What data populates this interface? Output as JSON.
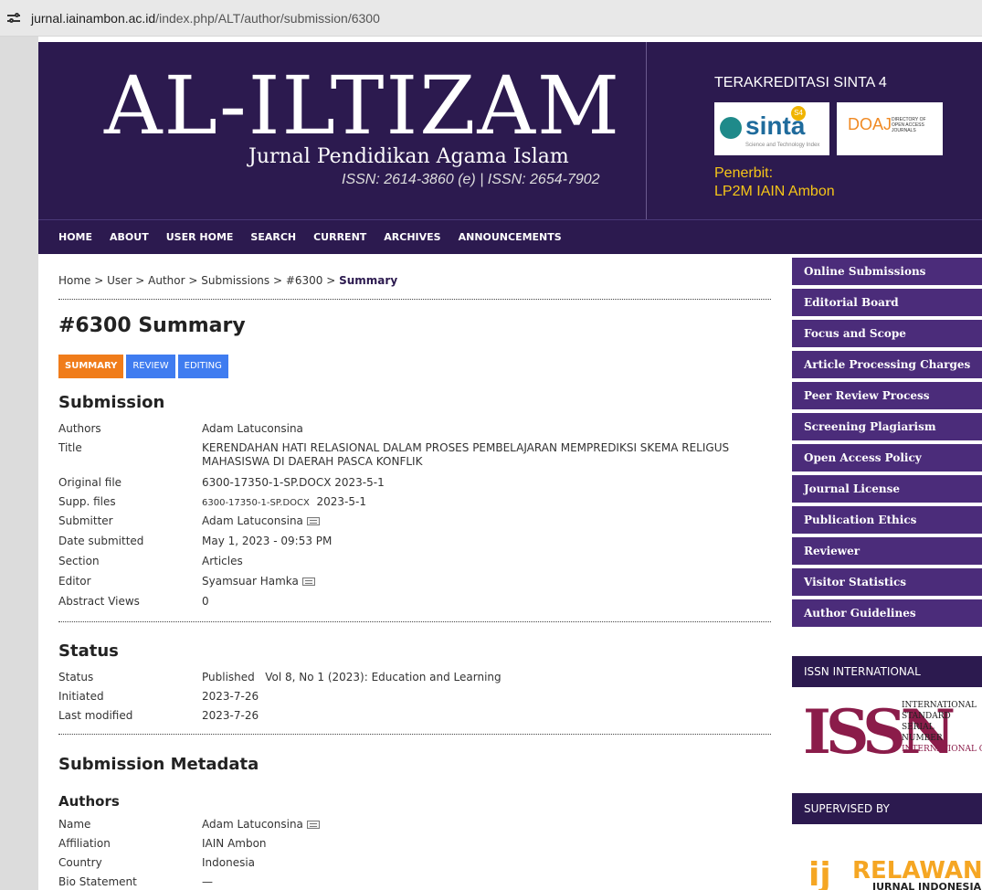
{
  "browser": {
    "url_host": "jurnal.iainambon.ac.id",
    "url_path": "/index.php/ALT/author/submission/6300"
  },
  "banner": {
    "title": "AL-ILTIZAM",
    "subtitle": "Jurnal Pendidikan Agama Islam",
    "issn": "ISSN: 2614-3860 (e) | ISSN: 2654-7902",
    "accreditation": "TERAKREDITASI SINTA 4",
    "sinta_word": "sinta",
    "sinta_badge": "S4",
    "sinta_tag": "Science and Technology Index",
    "doaj_word": "DOAJ",
    "doaj_small": "DIRECTORY OF OPEN ACCESS JOURNALS",
    "publisher_label": "Penerbit:",
    "publisher_name": "LP2M IAIN Ambon"
  },
  "nav": [
    "HOME",
    "ABOUT",
    "USER HOME",
    "SEARCH",
    "CURRENT",
    "ARCHIVES",
    "ANNOUNCEMENTS"
  ],
  "breadcrumb": {
    "trail": "Home > User > Author > Submissions > #6300 > ",
    "current": "Summary"
  },
  "page_title": "#6300 Summary",
  "tabs": [
    "SUMMARY",
    "REVIEW",
    "EDITING"
  ],
  "submission": {
    "heading": "Submission",
    "rows": [
      {
        "k": "Authors",
        "v": "Adam Latuconsina"
      },
      {
        "k": "Title",
        "v": "KERENDAHAN HATI RELASIONAL DALAM PROSES PEMBELAJARAN MEMPREDIKSI SKEMA RELIGUS MAHASISWA DI DAERAH PASCA KONFLIK"
      },
      {
        "k": "Original file",
        "v": "6300-17350-1-SP.DOCX 2023-5-1"
      },
      {
        "k": "Supp. files",
        "v": "6300-17350-1-SP.DOCX",
        "v2": "2023-5-1"
      },
      {
        "k": "Submitter",
        "v": "Adam Latuconsina"
      },
      {
        "k": "Date submitted",
        "v": "May 1, 2023 - 09:53 PM"
      },
      {
        "k": "Section",
        "v": "Articles"
      },
      {
        "k": "Editor",
        "v": "Syamsuar Hamka"
      },
      {
        "k": "Abstract Views",
        "v": "0"
      }
    ]
  },
  "status": {
    "heading": "Status",
    "rows": [
      {
        "k": "Status",
        "v": "Published   Vol 8, No 1 (2023): Education and Learning"
      },
      {
        "k": "Initiated",
        "v": "2023-7-26"
      },
      {
        "k": "Last modified",
        "v": "2023-7-26"
      }
    ]
  },
  "metadata": {
    "heading": "Submission Metadata",
    "authors_heading": "Authors",
    "rows": [
      {
        "k": "Name",
        "v": "Adam Latuconsina"
      },
      {
        "k": "Affiliation",
        "v": "IAIN Ambon"
      },
      {
        "k": "Country",
        "v": "Indonesia"
      },
      {
        "k": "Bio Statement",
        "v": "—"
      }
    ]
  },
  "sidebar": {
    "items": [
      "Online Submissions",
      "Editorial Board",
      "Focus and Scope",
      "Article Processing Charges",
      "Peer Review Process",
      "Screening Plagiarism",
      "Open Access Policy",
      "Journal License",
      "Publication Ethics",
      "Reviewer",
      "Visitor Statistics",
      "Author Guidelines"
    ],
    "issn_heading": "ISSN INTERNATIONAL",
    "issn_mark": "ISSN",
    "issn_lines": [
      "INTERNATIONAL",
      "STANDARD",
      "SERIAL",
      "NUMBER",
      "INTERNATIONAL CENTRE"
    ],
    "supervised_heading": "SUPERVISED BY",
    "relawan_word": "RELAWAN",
    "relawan_sub": "JURNAL INDONESIA"
  },
  "colors": {
    "banner": "#2c1a4f",
    "sidebar_item": "#4b2c7a",
    "tab_active": "#f07c1a",
    "tab_blue": "#3f7cf0"
  }
}
